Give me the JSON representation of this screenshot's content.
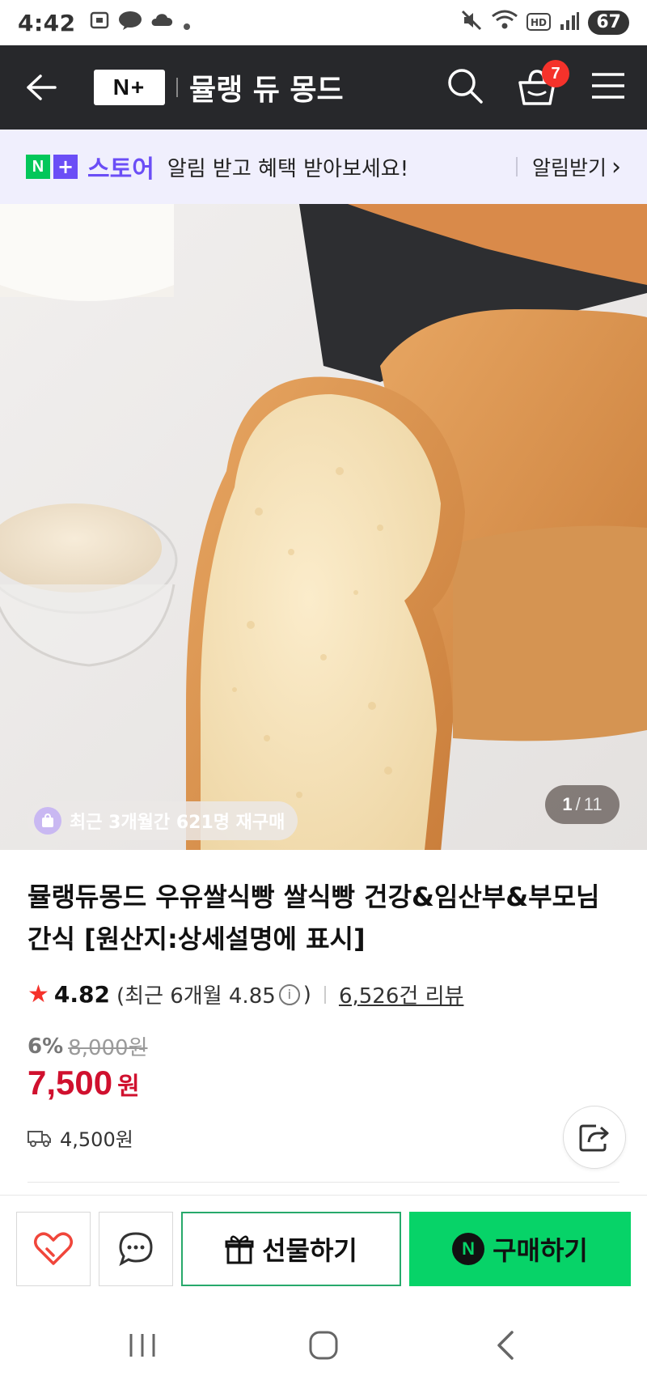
{
  "status_bar": {
    "time": "4:42",
    "battery": "67",
    "left_icons": [
      "screenshot-icon",
      "kakaotalk-icon",
      "cloud-icon",
      "dot-icon"
    ],
    "right_icons": [
      "mute-icon",
      "wifi-icon",
      "hd-icon",
      "signal-icon"
    ]
  },
  "header": {
    "logo": "N+",
    "store_name": "뮬랭 듀 몽드",
    "cart_count": "7"
  },
  "notify_banner": {
    "brand_n": "N",
    "brand_plus": "+",
    "brand_store": "스토어",
    "text": "알림 받고 혜택 받아보세요!",
    "action": "알림받기",
    "action_chevron": "›"
  },
  "hero": {
    "repurchase_badge": "최근 3개월간 621명 재구매",
    "counter_current": "1",
    "counter_sep": "/",
    "counter_total": "11"
  },
  "product": {
    "title": "뮬랭듀몽드 우유쌀식빵 쌀식빵 건강&임산부&부모님 간식 [원산지:상세설명에 표시]",
    "rating_star": "★",
    "rating": "4.82",
    "recent_rating_prefix": "(최근 6개월 4.85",
    "recent_rating_info": "i",
    "recent_rating_suffix": ")",
    "review_count": "6,526건 리뷰",
    "discount_pct": "6%",
    "original_price": "8,000원",
    "price": "7,500",
    "price_unit": "원",
    "shipping_fee": "4,500원"
  },
  "actions": {
    "like_icon": "heart-icon",
    "talk_icon": "chat-icon",
    "gift_label": "선물하기",
    "buy_label": "구매하기",
    "buy_badge": "N"
  },
  "colors": {
    "header_bg": "#27282b",
    "accent_green": "#07d368",
    "price_red": "#d0102e",
    "store_purple": "#6b4ef6",
    "badge_red": "#f5322b"
  }
}
